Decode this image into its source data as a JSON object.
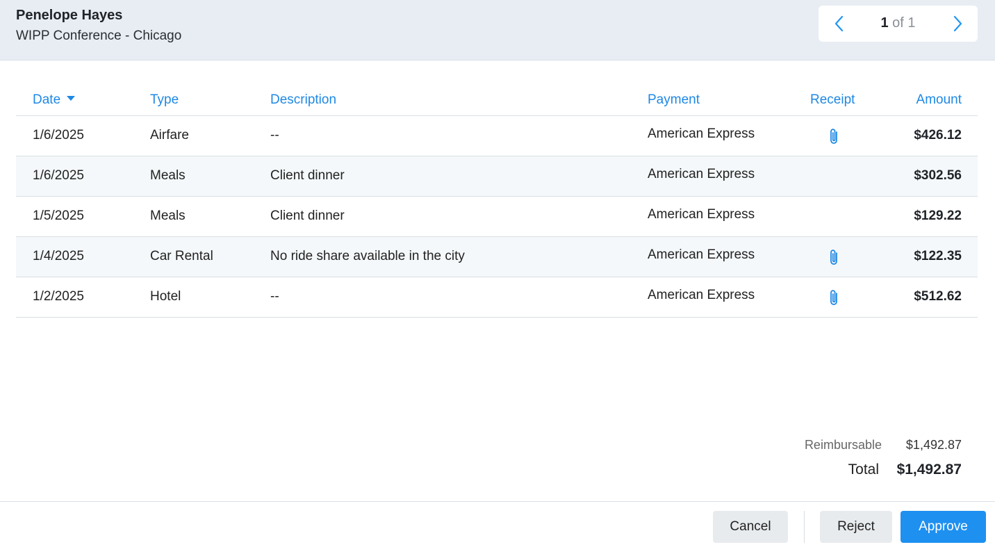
{
  "header": {
    "employee_name": "Penelope Hayes",
    "report_name": "WIPP Conference - Chicago",
    "pager": {
      "current": "1",
      "of_text": "of 1"
    }
  },
  "table": {
    "columns": {
      "date": "Date",
      "type": "Type",
      "description": "Description",
      "payment": "Payment",
      "receipt": "Receipt",
      "amount": "Amount"
    },
    "rows": [
      {
        "date": "1/6/2025",
        "type": "Airfare",
        "description": "--",
        "payment": "American Express",
        "receipt": true,
        "amount": "$426.12"
      },
      {
        "date": "1/6/2025",
        "type": "Meals",
        "description": "Client dinner",
        "payment": "American Express",
        "receipt": false,
        "amount": "$302.56"
      },
      {
        "date": "1/5/2025",
        "type": "Meals",
        "description": "Client dinner",
        "payment": "American Express",
        "receipt": false,
        "amount": "$129.22"
      },
      {
        "date": "1/4/2025",
        "type": "Car Rental",
        "description": "No ride share available in the city",
        "payment": "American Express",
        "receipt": true,
        "amount": "$122.35"
      },
      {
        "date": "1/2/2025",
        "type": "Hotel",
        "description": "--",
        "payment": "American Express",
        "receipt": true,
        "amount": "$512.62"
      }
    ]
  },
  "totals": {
    "reimbursable_label": "Reimbursable",
    "reimbursable_value": "$1,492.87",
    "total_label": "Total",
    "total_value": "$1,492.87"
  },
  "footer": {
    "cancel_label": "Cancel",
    "reject_label": "Reject",
    "approve_label": "Approve"
  },
  "colors": {
    "accent": "#1e88e5",
    "header_bg": "#e8edf3",
    "alt_row_bg": "#f4f8fa",
    "approve_bg": "#1e90f0"
  },
  "icons": {
    "sort": "caret-down-icon",
    "prev": "chevron-left-icon",
    "next": "chevron-right-icon",
    "receipt": "paperclip-icon"
  }
}
